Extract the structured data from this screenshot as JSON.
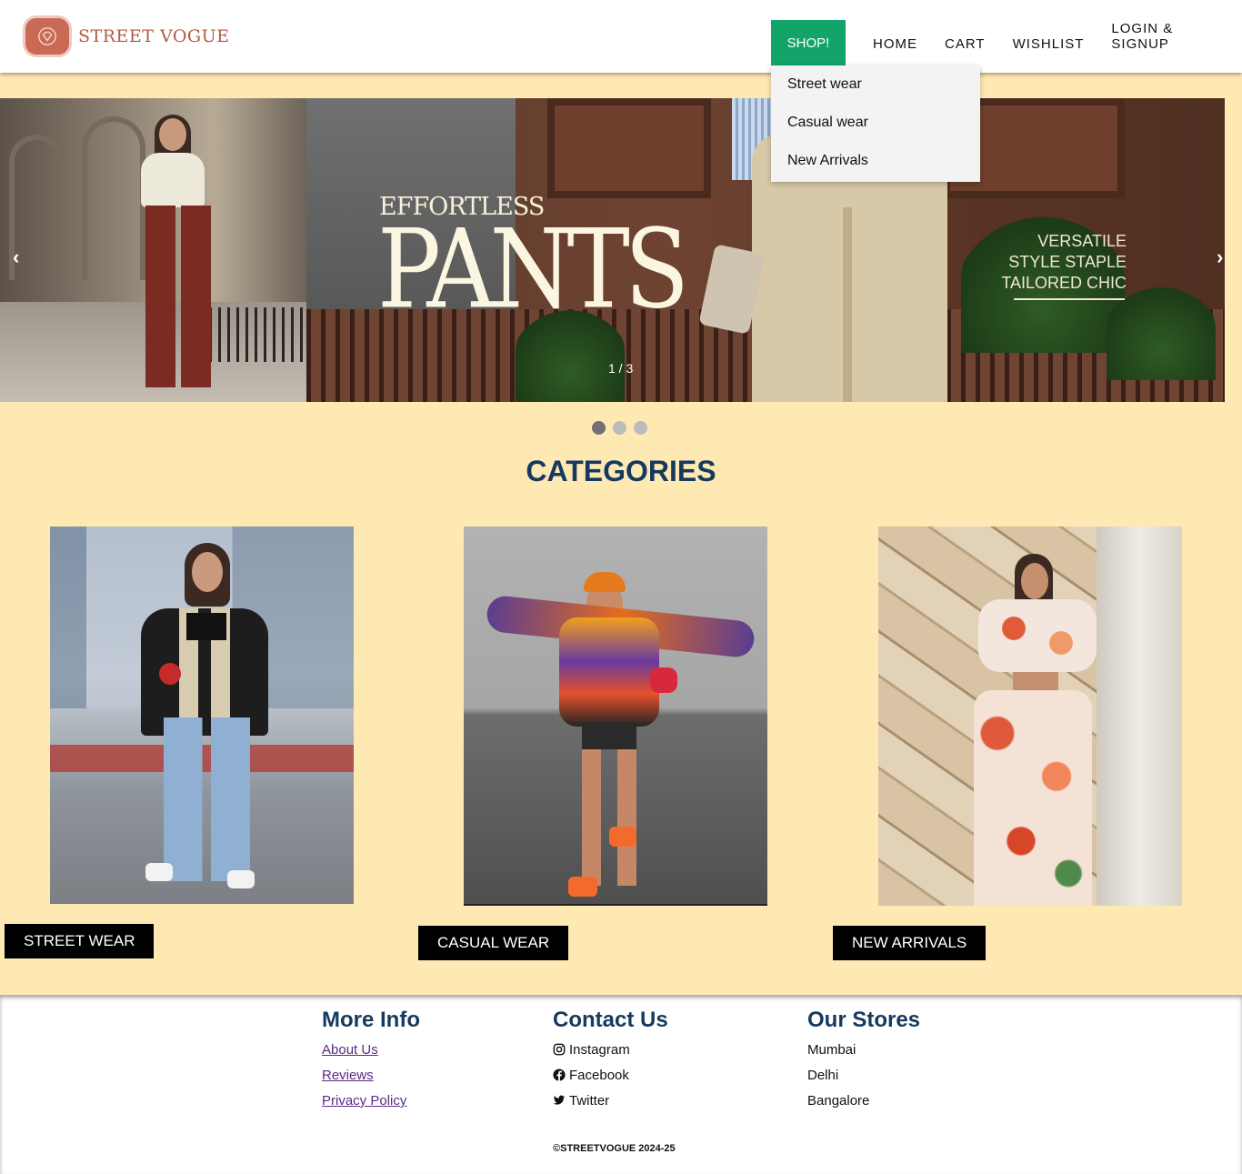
{
  "brand": {
    "name": "STREET VOGUE"
  },
  "nav": {
    "shop": "SHOP!",
    "home": "HOME",
    "cart": "CART",
    "wishlist": "WISHLIST",
    "login": "LOGIN & SIGNUP"
  },
  "dropdown": {
    "items": [
      "Street wear",
      "Casual wear",
      "New Arrivals"
    ]
  },
  "carousel": {
    "headline_small": "EFFORTLESS",
    "headline_big": "PANTS",
    "tagline": [
      "VERSATILE",
      "STYLE STAPLE",
      "TAILORED CHIC"
    ],
    "counter": "1 / 3",
    "prev": "‹",
    "next": "›",
    "total_slides": 3,
    "active_slide": 1
  },
  "categories": {
    "title": "CATEGORIES",
    "items": [
      {
        "label": "STREET WEAR"
      },
      {
        "label": "CASUAL WEAR"
      },
      {
        "label": "NEW ARRIVALS"
      }
    ]
  },
  "footer": {
    "more_info": {
      "title": "More Info",
      "links": [
        "About Us",
        "Reviews",
        "Privacy Policy"
      ]
    },
    "contact": {
      "title": "Contact Us",
      "links": [
        "Instagram",
        "Facebook",
        "Twitter"
      ]
    },
    "stores": {
      "title": "Our Stores",
      "items": [
        "Mumbai",
        "Delhi",
        "Bangalore"
      ]
    },
    "copyright": "©STREETVOGUE 2024-25"
  },
  "colors": {
    "accent": "#13a46a",
    "background": "#ffe9b3",
    "heading": "#163a5f",
    "brand": "#b45a44"
  }
}
